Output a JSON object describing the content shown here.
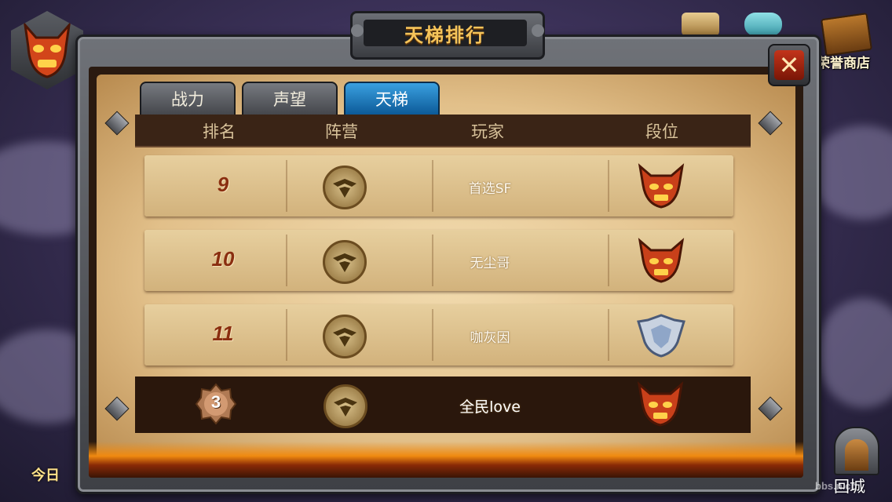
{
  "title": "天梯排行",
  "close_label": "✕",
  "shop_label": "荣誉商店",
  "tabs": [
    {
      "label": "战力",
      "active": false
    },
    {
      "label": "声望",
      "active": false
    },
    {
      "label": "天梯",
      "active": true
    }
  ],
  "headers": {
    "rank": "排名",
    "faction": "阵营",
    "player": "玩家",
    "tier": "段位"
  },
  "rows": [
    {
      "rank": "9",
      "player": "首选SF",
      "tier_icon": "demon-tier-icon",
      "faction_icon": "eagle-faction-icon"
    },
    {
      "rank": "10",
      "player": "无尘哥",
      "tier_icon": "demon-tier-icon",
      "faction_icon": "eagle-faction-icon"
    },
    {
      "rank": "11",
      "player": "咖灰因",
      "tier_icon": "silver-shield-tier-icon",
      "faction_icon": "eagle-faction-icon"
    }
  ],
  "self_row": {
    "rank": "3",
    "player": "全民love",
    "tier_icon": "demon-tier-icon",
    "faction_icon": "eagle-faction-icon"
  },
  "bottom": {
    "today_label": "今日",
    "home_label": "回城"
  },
  "watermark": "bbs.n.cn",
  "colors": {
    "title_gold": "#f6c45a",
    "active_tab": "#1f7fc4",
    "rank_red": "#8a2e10"
  }
}
